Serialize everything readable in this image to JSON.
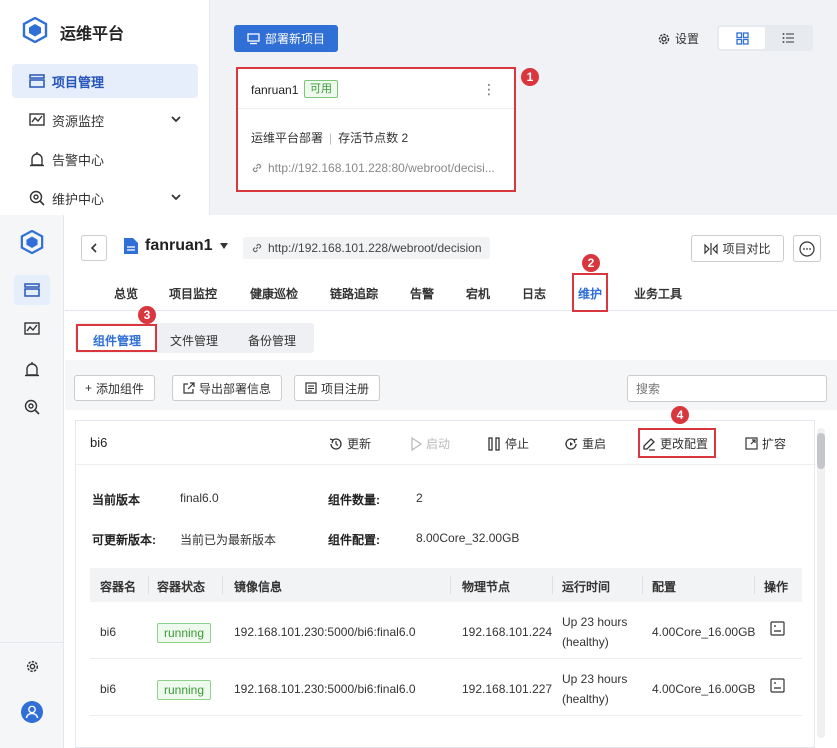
{
  "top": {
    "logo_text": "运维平台",
    "nav": [
      {
        "label": "项目管理",
        "active": true
      },
      {
        "label": "资源监控",
        "has_chevron": true
      },
      {
        "label": "告警中心"
      },
      {
        "label": "维护中心",
        "has_chevron": true
      }
    ],
    "deploy_button": "部署新项目",
    "settings_label": "设置",
    "project_card": {
      "name": "fanruan1",
      "status": "可用",
      "deploy_info": "运维平台部署",
      "node_info": "存活节点数 2",
      "url": "http://192.168.101.228:80/webroot/decisi..."
    }
  },
  "markers": [
    "1",
    "2",
    "3",
    "4"
  ],
  "header": {
    "project_name": "fanruan1",
    "url": "http://192.168.101.228/webroot/decision",
    "compare_button": "项目对比"
  },
  "tabs": [
    "总览",
    "项目监控",
    "健康巡检",
    "链路追踪",
    "告警",
    "宕机",
    "日志",
    "维护",
    "业务工具"
  ],
  "subtabs": [
    "组件管理",
    "文件管理",
    "备份管理"
  ],
  "toolbar": {
    "add_component": "添加组件",
    "export_deploy": "导出部署信息",
    "register": "项目注册",
    "search_placeholder": "搜索"
  },
  "component": {
    "name": "bi6",
    "actions": [
      "更新",
      "启动",
      "停止",
      "重启",
      "更改配置",
      "扩容"
    ],
    "current_version_label": "当前版本",
    "current_version": "final6.0",
    "count_label": "组件数量:",
    "count": "2",
    "updatable_label": "可更新版本:",
    "updatable": "当前已为最新版本",
    "config_label": "组件配置:",
    "config": "8.00Core_32.00GB"
  },
  "table": {
    "headers": [
      "容器名",
      "容器状态",
      "镜像信息",
      "物理节点",
      "运行时间",
      "配置",
      "操作"
    ],
    "rows": [
      {
        "name": "bi6",
        "status": "running",
        "image": "192.168.101.230:5000/bi6:final6.0",
        "node": "192.168.101.224",
        "uptime1": "Up 23 hours",
        "uptime2": "(healthy)",
        "config": "4.00Core_16.00GB"
      },
      {
        "name": "bi6",
        "status": "running",
        "image": "192.168.101.230:5000/bi6:final6.0",
        "node": "192.168.101.227",
        "uptime1": "Up 23 hours",
        "uptime2": "(healthy)",
        "config": "4.00Core_16.00GB"
      }
    ]
  },
  "colors": {
    "primary": "#2f6fd6",
    "marker": "#d9363e",
    "success": "#3a9a37"
  }
}
